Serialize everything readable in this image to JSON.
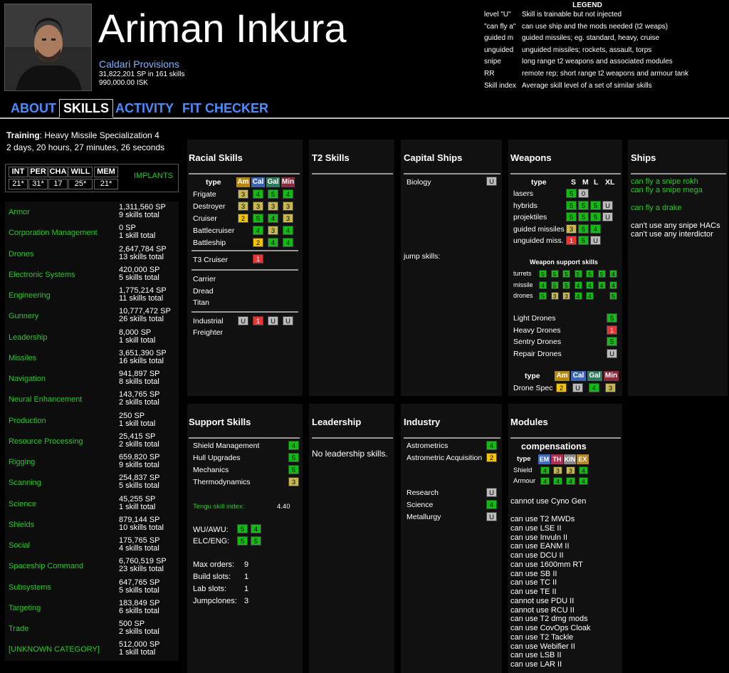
{
  "character": {
    "name": "Ariman Inkura",
    "corporation": "Caldari Provisions",
    "sp_summary": "31,822,201 SP in 161 skills",
    "isk": "990,000.00 ISK"
  },
  "legend": {
    "title": "LEGEND",
    "rows": [
      {
        "key": "level \"U\"",
        "text": "Skill is trainable but not injected"
      },
      {
        "key": "\"can fly a\"",
        "text": "can use ship and the mods needed (t2 weaps)"
      },
      {
        "key": "guided m",
        "text": "guided missiles; eg. standard, heavy, cruise"
      },
      {
        "key": "unguided",
        "text": "unguided missiles; rockets, assault, torps"
      },
      {
        "key": "snipe",
        "text": "long range t2 weapons and associated modules"
      },
      {
        "key": "RR",
        "text": "remote rep; short range t2 weapons and armour tank"
      },
      {
        "key": "Skill index",
        "text": "Average skill level of a set of similar skills"
      }
    ]
  },
  "tabs": [
    "ABOUT",
    "SKILLS",
    "ACTIVITY",
    "FIT CHECKER"
  ],
  "training": {
    "label": "Training",
    "skill": ": Heavy Missile Specialization 4",
    "time": "2 days, 20 hours, 27 minutes, 26 seconds"
  },
  "attributes": {
    "headers": [
      "INT",
      "PER",
      "CHA",
      "WILL",
      "MEM"
    ],
    "values": [
      "21*",
      "31*",
      "17",
      "25*",
      "21*"
    ],
    "implants_label": "IMPLANTS"
  },
  "categories": [
    {
      "name": "Armor",
      "sp": "1,311,560 SP",
      "count": "9 skills total"
    },
    {
      "name": "Corporation Management",
      "sp": "0 SP",
      "count": "1 skill total"
    },
    {
      "name": "Drones",
      "sp": "2,647,784 SP",
      "count": "13 skills total"
    },
    {
      "name": "Electronic Systems",
      "sp": "420,000 SP",
      "count": "5 skills total"
    },
    {
      "name": "Engineering",
      "sp": "1,775,214 SP",
      "count": "11 skills total"
    },
    {
      "name": "Gunnery",
      "sp": "10,777,472 SP",
      "count": "26 skills total"
    },
    {
      "name": "Leadership",
      "sp": "8,000 SP",
      "count": "1 skill total"
    },
    {
      "name": "Missiles",
      "sp": "3,651,390 SP",
      "count": "16 skills total"
    },
    {
      "name": "Navigation",
      "sp": "941,897 SP",
      "count": "8 skills total"
    },
    {
      "name": "Neural Enhancement",
      "sp": "143,765 SP",
      "count": "2 skills total"
    },
    {
      "name": "Production",
      "sp": "250 SP",
      "count": "1 skill total"
    },
    {
      "name": "Resource Processing",
      "sp": "25,415 SP",
      "count": "2 skills total"
    },
    {
      "name": "Rigging",
      "sp": "659,820 SP",
      "count": "9 skills total"
    },
    {
      "name": "Scanning",
      "sp": "254,837 SP",
      "count": "5 skills total"
    },
    {
      "name": "Science",
      "sp": "45,255 SP",
      "count": "1 skill total"
    },
    {
      "name": "Shields",
      "sp": "879,144 SP",
      "count": "10 skills total"
    },
    {
      "name": "Social",
      "sp": "175,765 SP",
      "count": "4 skills total"
    },
    {
      "name": "Spaceship Command",
      "sp": "6,760,519 SP",
      "count": "23 skills total"
    },
    {
      "name": "Subsystems",
      "sp": "647,765 SP",
      "count": "5 skills total"
    },
    {
      "name": "Targeting",
      "sp": "183,849 SP",
      "count": "6 skills total"
    },
    {
      "name": "Trade",
      "sp": "500 SP",
      "count": "2 skills total"
    },
    {
      "name": "[UNKNOWN CATEGORY]",
      "sp": "512,000 SP",
      "count": "1 skill total"
    }
  ],
  "panels": {
    "racial": {
      "title": "Racial Skills",
      "type_label": "type",
      "races": [
        "Am",
        "Cal",
        "Gal",
        "Min"
      ],
      "rows": [
        {
          "name": "Frigate",
          "levels": [
            "3",
            "4",
            "5",
            "4"
          ]
        },
        {
          "name": "Destroyer",
          "levels": [
            "3",
            "3",
            "3",
            "3"
          ]
        },
        {
          "name": "Cruiser",
          "levels": [
            "2",
            "5",
            "4",
            "3"
          ]
        },
        {
          "name": "Battlecruiser",
          "levels": [
            "",
            "4",
            "3",
            "4"
          ]
        },
        {
          "name": "Battleship",
          "levels": [
            "",
            "2",
            "4",
            "4"
          ]
        }
      ],
      "t3_label": "T3 Cruiser",
      "t3_level": "1",
      "capitals": [
        "Carrier",
        "Dread",
        "Titan"
      ],
      "industrial_label": "Industrial",
      "industrial_levels": [
        "U",
        "1",
        "U",
        "U"
      ],
      "freighter_label": "Freighter"
    },
    "t2": {
      "title": "T2 Skills"
    },
    "capital": {
      "title": "Capital Ships",
      "biology_label": "Biology",
      "biology_level": "U",
      "jump_label": "jump skills:"
    },
    "weapons": {
      "title": "Weapons",
      "type_label": "type",
      "sizes": [
        "S",
        "M",
        "L",
        "XL"
      ],
      "rows": [
        {
          "name": "lasers",
          "levels": [
            "5",
            "0",
            "",
            ""
          ]
        },
        {
          "name": "hybrids",
          "levels": [
            "5",
            "5",
            "5",
            "U"
          ]
        },
        {
          "name": "projektiles",
          "levels": [
            "5",
            "5",
            "5",
            "U"
          ]
        },
        {
          "name": "guided missiles",
          "levels": [
            "3",
            "5",
            "4",
            ""
          ]
        },
        {
          "name": "unguided miss.",
          "levels": [
            "1",
            "5",
            "U",
            ""
          ]
        }
      ],
      "support_title": "Weapon support skills",
      "support_rows": [
        {
          "name": "turrets",
          "levels": [
            "5",
            "5",
            "5",
            "5",
            "5",
            "5",
            "4"
          ]
        },
        {
          "name": "missile",
          "levels": [
            "4",
            "5",
            "5",
            "4",
            "4",
            "4",
            "4"
          ]
        },
        {
          "name": "drones",
          "levels": [
            "5",
            "3",
            "3",
            "4",
            "4",
            "",
            "5"
          ]
        }
      ],
      "drones": [
        {
          "name": "Light Drones",
          "level": "5"
        },
        {
          "name": "Heavy Drones",
          "level": "1"
        },
        {
          "name": "Sentry Drones",
          "level": "5"
        },
        {
          "name": "Repair Drones",
          "level": "U"
        }
      ],
      "drone_spec_label": "Drone Spec",
      "drone_spec_levels": [
        "2",
        "U",
        "4",
        "3"
      ]
    },
    "ships": {
      "title": "Ships",
      "can_fly": [
        "can fly a snipe rokh",
        "can fly a snipe mega",
        "can fly a drake"
      ],
      "cant": [
        "can't use any snipe HACs",
        "can't use any interdictor"
      ]
    },
    "support": {
      "title": "Support Skills",
      "rows": [
        {
          "name": "Shield Management",
          "level": "4"
        },
        {
          "name": "Hull Upgrades",
          "level": "5"
        },
        {
          "name": "Mechanics",
          "level": "5"
        },
        {
          "name": "Thermodynamics",
          "level": "3"
        }
      ],
      "tengu_label": "Tengu skill index:",
      "tengu_value": "4.40",
      "wu_label": "WU/AWU:",
      "wu_levels": [
        "5",
        "4"
      ],
      "elc_label": "ELC/ENG:",
      "elc_levels": [
        "5",
        "5"
      ],
      "stats": [
        {
          "label": "Max orders:",
          "value": "9"
        },
        {
          "label": "Build slots:",
          "value": "1"
        },
        {
          "label": "Lab slots:",
          "value": "1"
        },
        {
          "label": "Jumpclones:",
          "value": "3"
        }
      ]
    },
    "leadership": {
      "title": "Leadership",
      "text": "No leadership skills."
    },
    "industry": {
      "title": "Industry",
      "rows1": [
        {
          "name": "Astrometrics",
          "level": "4"
        },
        {
          "name": "Astrometric Acquisition",
          "level": "2"
        }
      ],
      "rows2": [
        {
          "name": "Research",
          "level": "U"
        },
        {
          "name": "Science",
          "level": "4"
        },
        {
          "name": "Metallurgy",
          "level": "U"
        }
      ]
    },
    "modules": {
      "title": "Modules",
      "comp_title": "compensations",
      "type_label": "type",
      "resists": [
        "EM",
        "TH",
        "KIN",
        "EX"
      ],
      "comp_rows": [
        {
          "name": "Shield",
          "levels": [
            "4",
            "3",
            "3",
            "4"
          ]
        },
        {
          "name": "Armour",
          "levels": [
            "4",
            "4",
            "4",
            "4"
          ]
        }
      ],
      "cyno": "cannot use Cyno Gen",
      "items": [
        "can use T2 MWDs",
        "can use LSE II",
        "can use Invuln II",
        "can use EANM II",
        "can use DCU II",
        "can use 1600mm RT",
        "can use SB II",
        "can use TC II",
        "can use TE II",
        "cannot use PDU II",
        "cannot use RCU II",
        "can use T2 dmg mods",
        "can use CovOps Cloak",
        "can use T2 Tackle",
        "can use Webifier II",
        "can use LSB II",
        "can use LAR II"
      ]
    }
  }
}
